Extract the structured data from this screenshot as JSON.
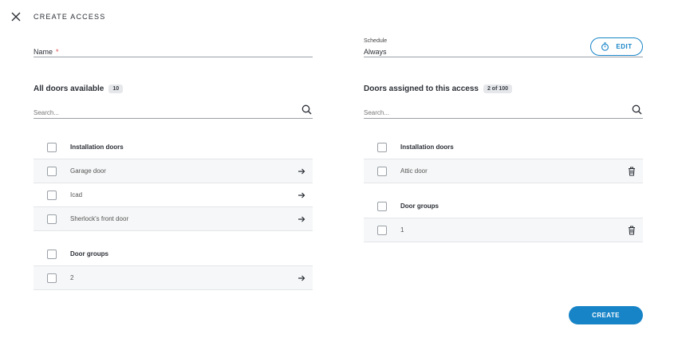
{
  "header": {
    "title": "CREATE ACCESS"
  },
  "name_field": {
    "label": "Name",
    "required_mark": "*",
    "value": ""
  },
  "schedule_field": {
    "label": "Schedule",
    "value": "Always"
  },
  "edit_button": {
    "label": "EDIT"
  },
  "available": {
    "title": "All doors available",
    "count": "10",
    "search_placeholder": "Search...",
    "groups": [
      {
        "label": "Installation doors",
        "items": [
          {
            "label": "Garage door"
          },
          {
            "label": "Icad"
          },
          {
            "label": "Sherlock's front door"
          }
        ]
      },
      {
        "label": "Door groups",
        "items": [
          {
            "label": "2"
          }
        ]
      }
    ]
  },
  "assigned": {
    "title": "Doors assigned to this access",
    "count": "2 of 100",
    "search_placeholder": "Search...",
    "groups": [
      {
        "label": "Installation doors",
        "items": [
          {
            "label": "Attic door"
          }
        ]
      },
      {
        "label": "Door groups",
        "items": [
          {
            "label": "1"
          }
        ]
      }
    ]
  },
  "create_button": {
    "label": "CREATE"
  },
  "colors": {
    "accent": "#1784c7",
    "required": "#e04848",
    "row_alt": "#f6f7f8"
  }
}
